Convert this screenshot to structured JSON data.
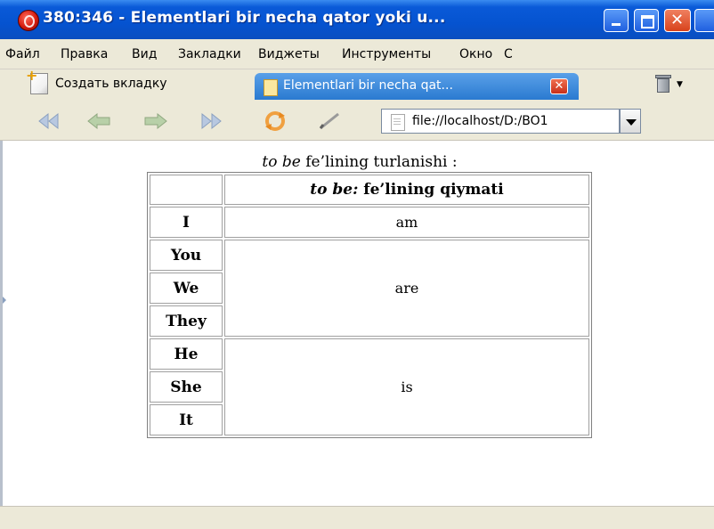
{
  "window": {
    "title": "380:346 - Elementlari bir necha qator yoki u..."
  },
  "menubar": {
    "items": [
      "Файл",
      "Правка",
      "Вид",
      "Закладки",
      "Виджеты",
      "Инструменты",
      "Окно",
      "С"
    ]
  },
  "tabs": {
    "new_tab_label": "Создать вкладку",
    "active_tab_label": "Elementlari bir necha qat..."
  },
  "toolbar": {
    "address": "file://localhost/D:/BO1"
  },
  "content": {
    "caption_italic": "to be",
    "caption_rest": " fe’lining turlanishi :",
    "table": {
      "header_italic": "to be:",
      "header_rest": " fe’lining qiymati",
      "groups": [
        {
          "pronouns": [
            "I"
          ],
          "value": "am"
        },
        {
          "pronouns": [
            "You",
            "We",
            "They"
          ],
          "value": "are"
        },
        {
          "pronouns": [
            "He",
            "She",
            "It"
          ],
          "value": "is"
        }
      ]
    }
  },
  "colors": {
    "titlebar": "#0553d0",
    "chrome": "#ece9d8",
    "active_tab": "#2a7ad0"
  }
}
